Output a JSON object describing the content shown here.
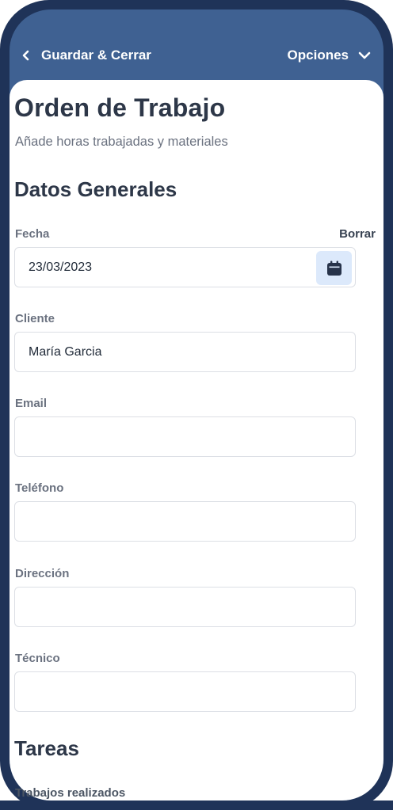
{
  "header": {
    "back_label": "Guardar & Cerrar",
    "options_label": "Opciones"
  },
  "page": {
    "title": "Orden de Trabajo",
    "subtitle": "Añade horas trabajadas y materiales"
  },
  "general": {
    "heading": "Datos Generales",
    "date": {
      "label": "Fecha",
      "clear_label": "Borrar",
      "value": "23/03/2023"
    },
    "client": {
      "label": "Cliente",
      "value": "María Garcia"
    },
    "email": {
      "label": "Email",
      "value": ""
    },
    "phone": {
      "label": "Teléfono",
      "value": ""
    },
    "address": {
      "label": "Dirección",
      "value": ""
    },
    "technician": {
      "label": "Técnico",
      "value": ""
    }
  },
  "tasks": {
    "heading": "Tareas",
    "work_done_label": "Trabajos realizados"
  },
  "colors": {
    "frame": "#1f3358",
    "header": "#3f6192",
    "accent_light": "#dce9fb",
    "text_dark": "#2d3748",
    "text_muted": "#6b7280"
  },
  "icons": {
    "back": "chevron-left-icon",
    "options": "chevron-down-icon",
    "date_picker": "calendar-icon"
  }
}
